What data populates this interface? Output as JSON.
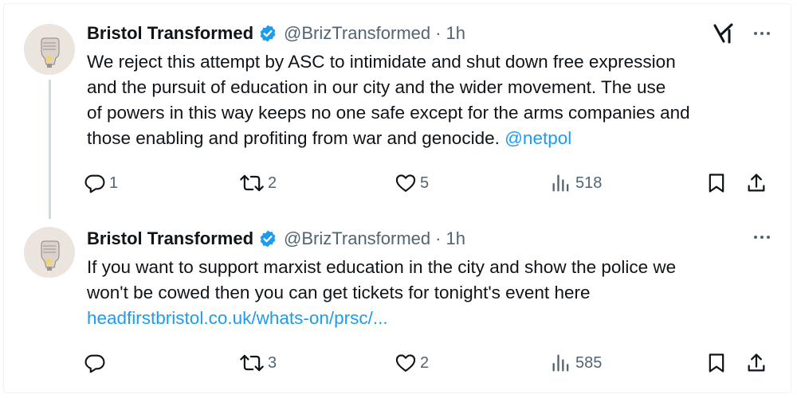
{
  "tweets": [
    {
      "author": "Bristol Transformed",
      "handle": "@BrizTransformed",
      "separator": "·",
      "time": "1h",
      "text_lines": [
        "We reject this attempt by ASC to intimidate and shut down free expression",
        "and the pursuit of education in our city and the wider movement. The use",
        "of powers in this way keeps no one safe except for the arms companies and",
        "those enabling and profiting from war and genocide. "
      ],
      "mention": "@netpol",
      "replies": "1",
      "reposts": "2",
      "likes": "5",
      "views": "518"
    },
    {
      "author": "Bristol Transformed",
      "handle": "@BrizTransformed",
      "separator": "·",
      "time": "1h",
      "text_lines": [
        "If you want to support marxist education in the city and show the police we",
        "won't be cowed then you can get tickets for tonight's event here"
      ],
      "link": "headfirstbristol.co.uk/whats-on/prsc/...",
      "replies": "",
      "reposts": "3",
      "likes": "2",
      "views": "585"
    }
  ],
  "icons": {
    "verified": "verified-badge-icon",
    "grok": "grok-icon",
    "more": "more-icon",
    "reply": "reply-icon",
    "repost": "repost-icon",
    "like": "like-icon",
    "views": "views-icon",
    "bookmark": "bookmark-icon",
    "share": "share-icon"
  },
  "colors": {
    "accent": "#1d9bf0",
    "secondary_text": "#536471",
    "thread_line": "#cfd9de"
  }
}
